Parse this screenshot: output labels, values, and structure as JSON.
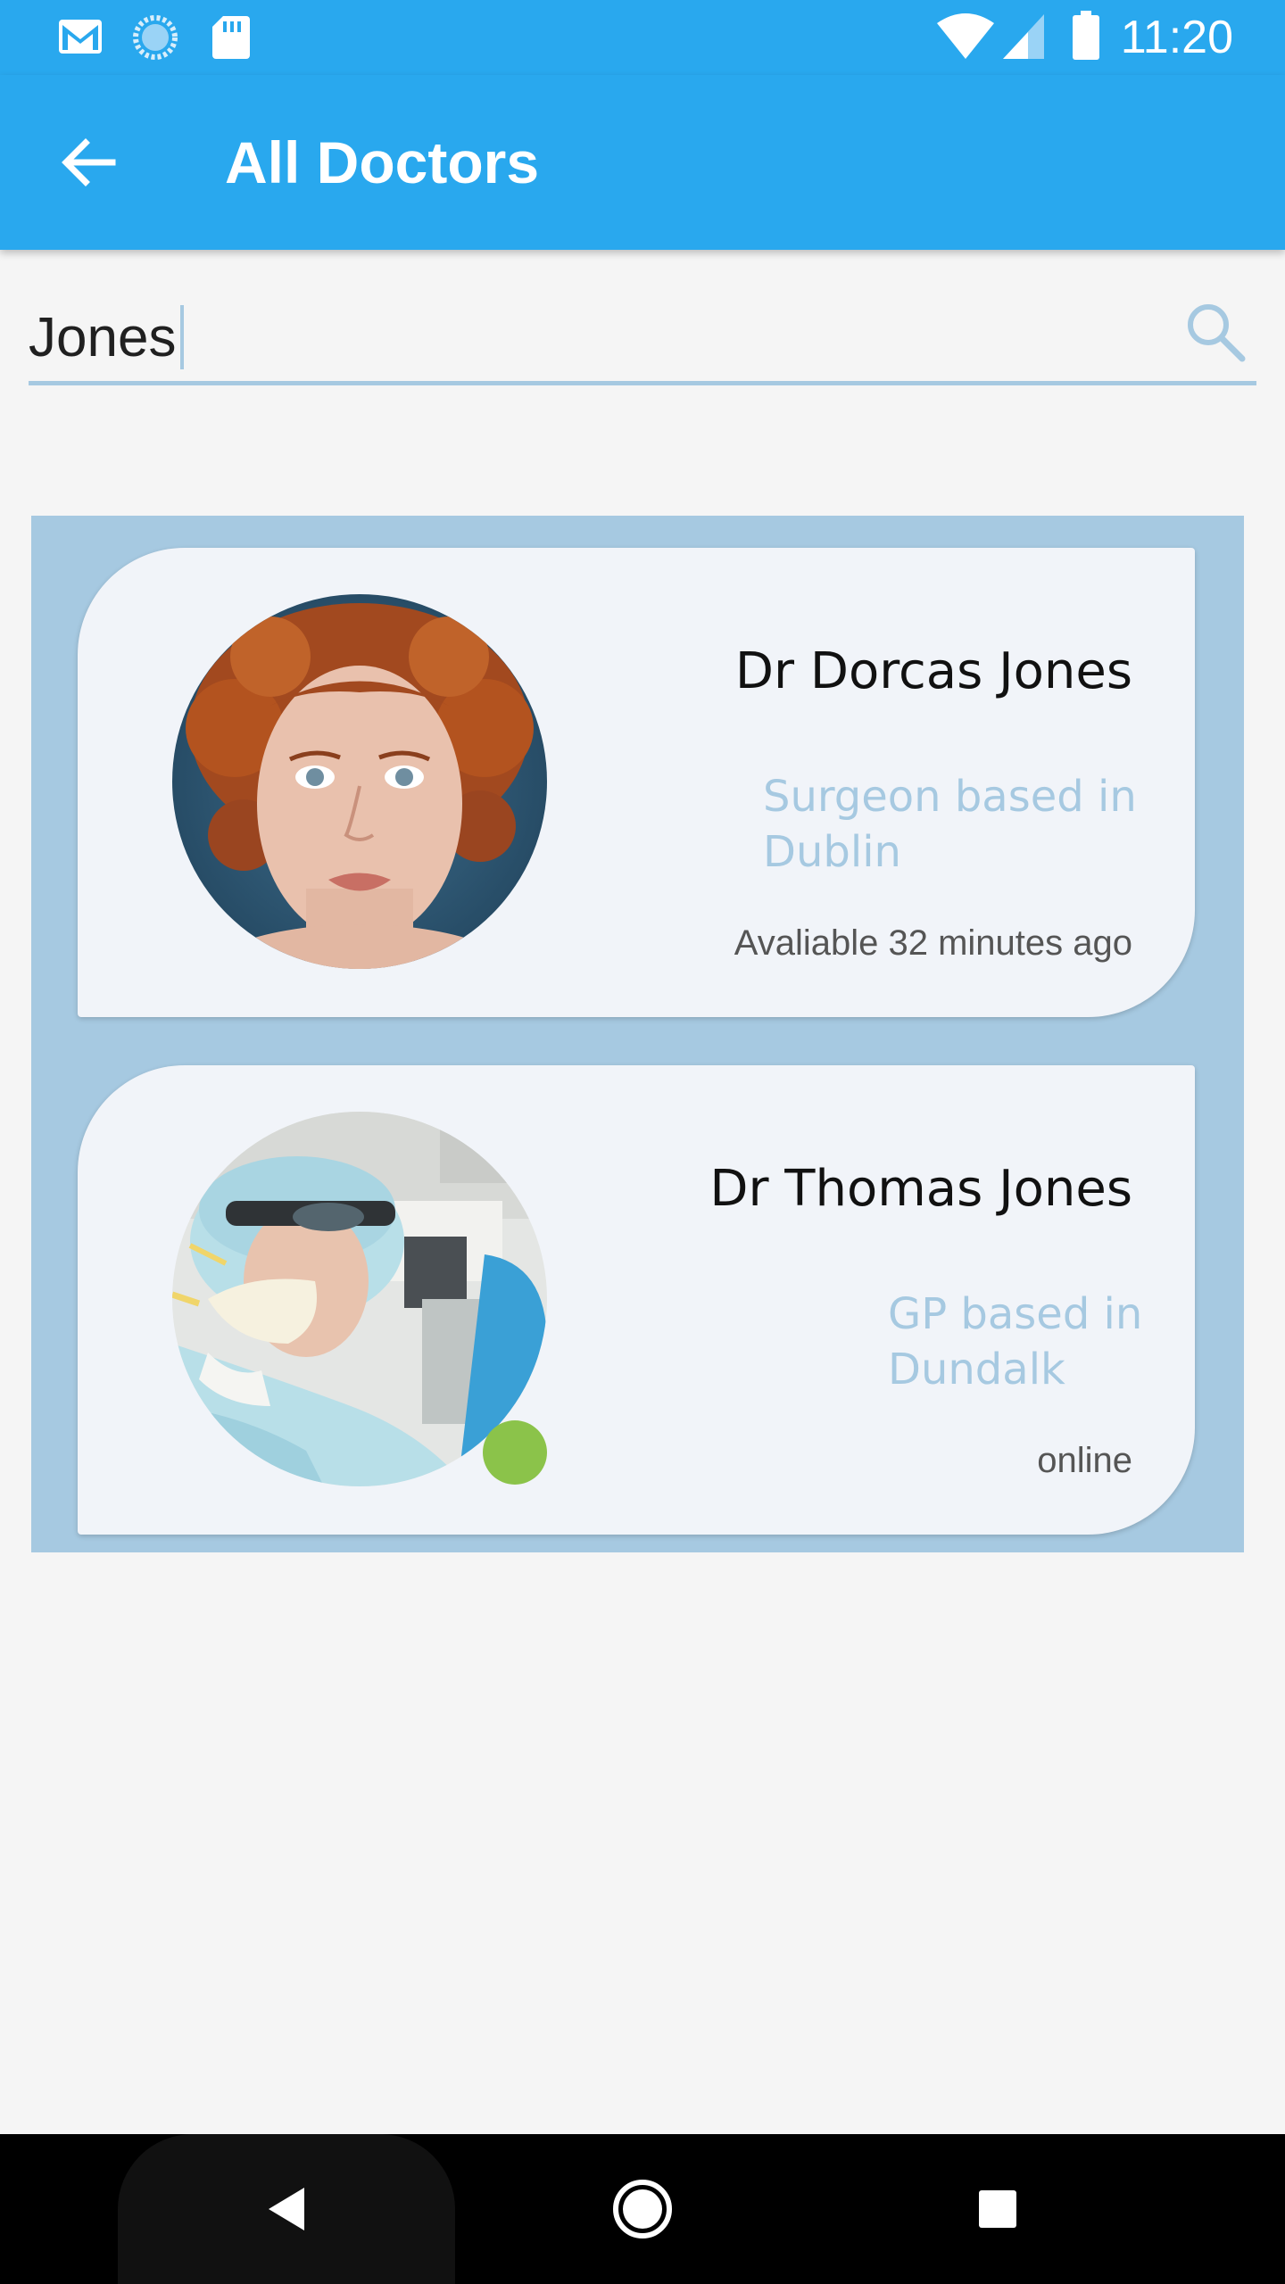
{
  "status_bar": {
    "time": "11:20",
    "left_icons": [
      "gmail-icon",
      "sync-icon",
      "sd-card-icon"
    ],
    "right_icons": [
      "wifi-icon",
      "cell-signal-icon",
      "battery-icon"
    ]
  },
  "app_bar": {
    "title": "All Doctors",
    "back_icon": "arrow-left-icon"
  },
  "search": {
    "value": "Jones",
    "icon": "search-icon"
  },
  "doctors": [
    {
      "name": "Dr Dorcas Jones",
      "description": "Surgeon based in Dublin",
      "status": "Avaliable 32 minutes ago",
      "online": false
    },
    {
      "name": "Dr Thomas Jones",
      "description": "GP based in Dundalk",
      "status": "online",
      "online": true
    }
  ],
  "colors": {
    "primary": "#29a8ee",
    "accent_light": "#a6c9e1",
    "card_bg": "#f1f4f9",
    "online": "#8bc34a"
  },
  "nav_bar": {
    "icons": [
      "nav-back-icon",
      "nav-home-icon",
      "nav-recents-icon"
    ]
  }
}
